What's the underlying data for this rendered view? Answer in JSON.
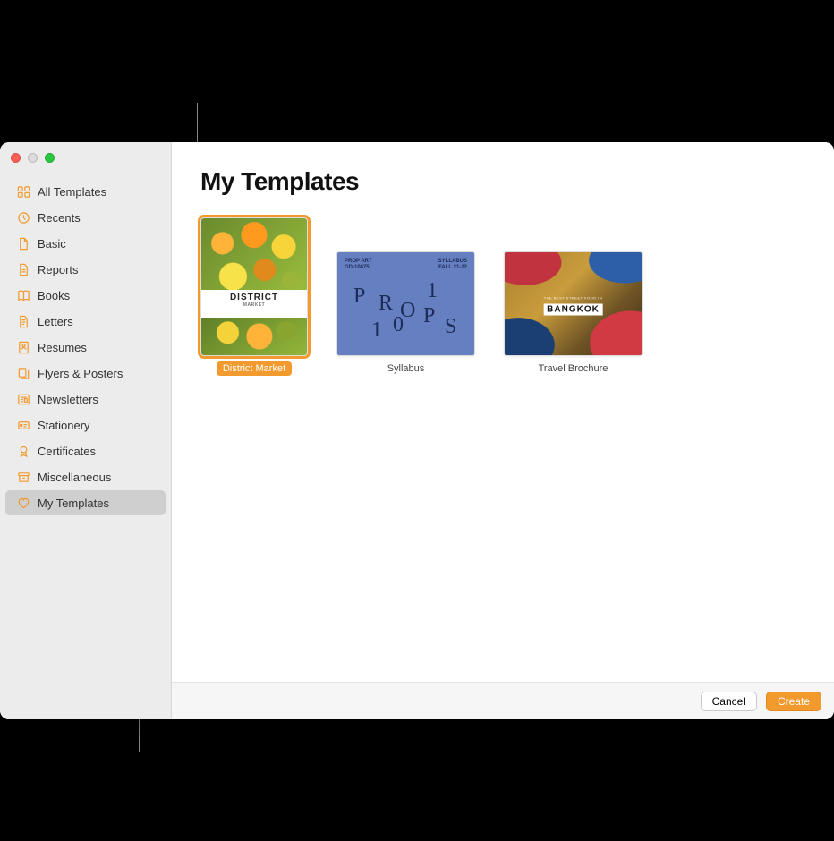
{
  "page_title": "My Templates",
  "sidebar": {
    "items": [
      {
        "label": "All Templates",
        "icon": "grid"
      },
      {
        "label": "Recents",
        "icon": "clock"
      },
      {
        "label": "Basic",
        "icon": "doc"
      },
      {
        "label": "Reports",
        "icon": "doc"
      },
      {
        "label": "Books",
        "icon": "book"
      },
      {
        "label": "Letters",
        "icon": "doc"
      },
      {
        "label": "Resumes",
        "icon": "person"
      },
      {
        "label": "Flyers & Posters",
        "icon": "layers"
      },
      {
        "label": "Newsletters",
        "icon": "news"
      },
      {
        "label": "Stationery",
        "icon": "card"
      },
      {
        "label": "Certificates",
        "icon": "ribbon"
      },
      {
        "label": "Miscellaneous",
        "icon": "archive"
      },
      {
        "label": "My Templates",
        "icon": "heart",
        "selected": true
      }
    ]
  },
  "templates": [
    {
      "label": "District Market",
      "selected": true,
      "thumb": {
        "title": "DISTRICT",
        "subtitle": "MARKET"
      }
    },
    {
      "label": "Syllabus",
      "thumb": {
        "header_left_1": "PROP ART",
        "header_left_2": "GD-10875",
        "header_right_1": "SYLLABUS",
        "header_right_2": "FALL 21-22",
        "letters": "P R O P 1 0 1 S"
      }
    },
    {
      "label": "Travel Brochure",
      "thumb": {
        "pretitle": "THE BEST STREET FOOD IN",
        "city": "BANGKOK"
      }
    }
  ],
  "footer": {
    "cancel": "Cancel",
    "create": "Create"
  },
  "colors": {
    "accent": "#f29a2e"
  }
}
